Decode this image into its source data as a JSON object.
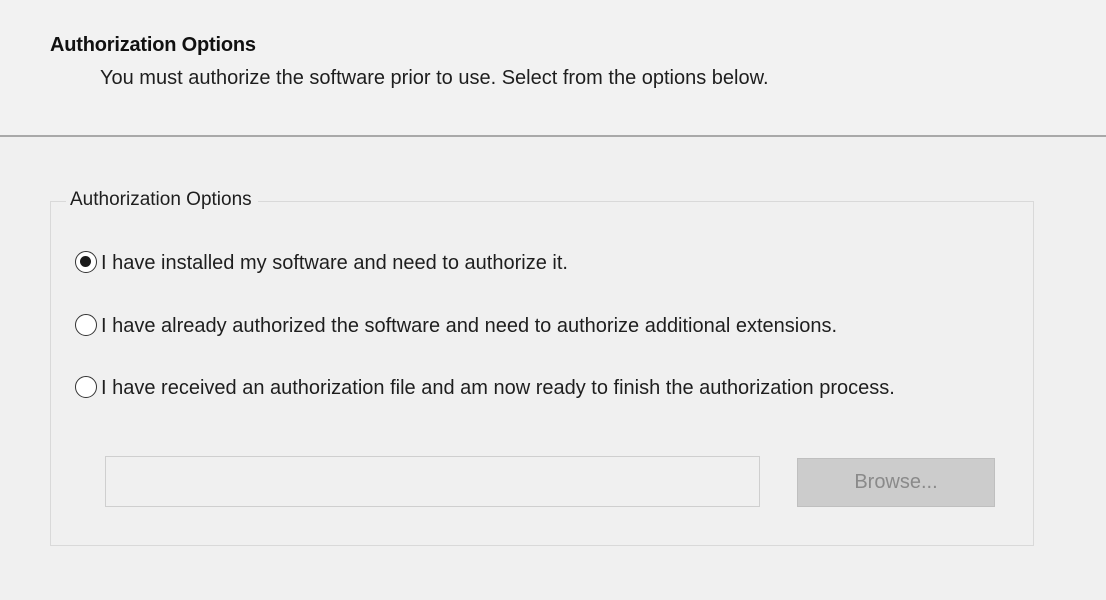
{
  "header": {
    "title": "Authorization Options",
    "subtitle": "You must authorize the software prior to use. Select from the options below."
  },
  "group": {
    "legend": "Authorization Options",
    "options": [
      {
        "label": "I have installed my software and need to authorize it.",
        "checked": true
      },
      {
        "label": "I have already authorized the software and need to authorize additional extensions.",
        "checked": false
      },
      {
        "label": "I have received an authorization file and am now ready to finish the authorization process.",
        "checked": false
      }
    ],
    "file_path": {
      "value": "",
      "placeholder": ""
    },
    "browse_label": "Browse..."
  }
}
